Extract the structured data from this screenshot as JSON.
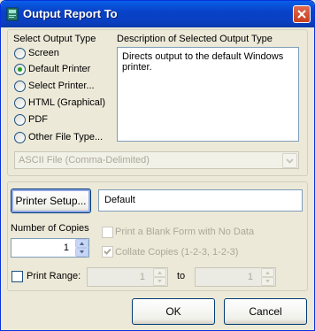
{
  "window": {
    "title": "Output Report To"
  },
  "output_type": {
    "group_label": "Select Output Type",
    "options": [
      {
        "label": "Screen",
        "checked": false
      },
      {
        "label": "Default Printer",
        "checked": true
      },
      {
        "label": "Select Printer...",
        "checked": false
      },
      {
        "label": "HTML (Graphical)",
        "checked": false
      },
      {
        "label": "PDF",
        "checked": false
      },
      {
        "label": "Other File Type...",
        "checked": false
      }
    ],
    "description_label": "Description of Selected Output Type",
    "description_text": "Directs output to the default Windows printer.",
    "file_type_value": "ASCII File (Comma-Delimited)"
  },
  "printer": {
    "setup_button": "Printer Setup...",
    "printer_name": "Default",
    "copies_label": "Number of Copies",
    "copies_value": "1",
    "blank_form_label": "Print a Blank Form with No Data",
    "blank_form_checked": false,
    "collate_label": "Collate Copies (1-2-3, 1-2-3)",
    "collate_checked": true,
    "print_range_label": "Print Range:",
    "print_range_checked": false,
    "range_from": "1",
    "range_to_label": "to",
    "range_to": "1"
  },
  "buttons": {
    "ok": "OK",
    "cancel": "Cancel"
  },
  "colors": {
    "title_bar": "#0A5FE8",
    "radio_dot": "#21A121",
    "dialog_bg": "#ECE9D8"
  }
}
